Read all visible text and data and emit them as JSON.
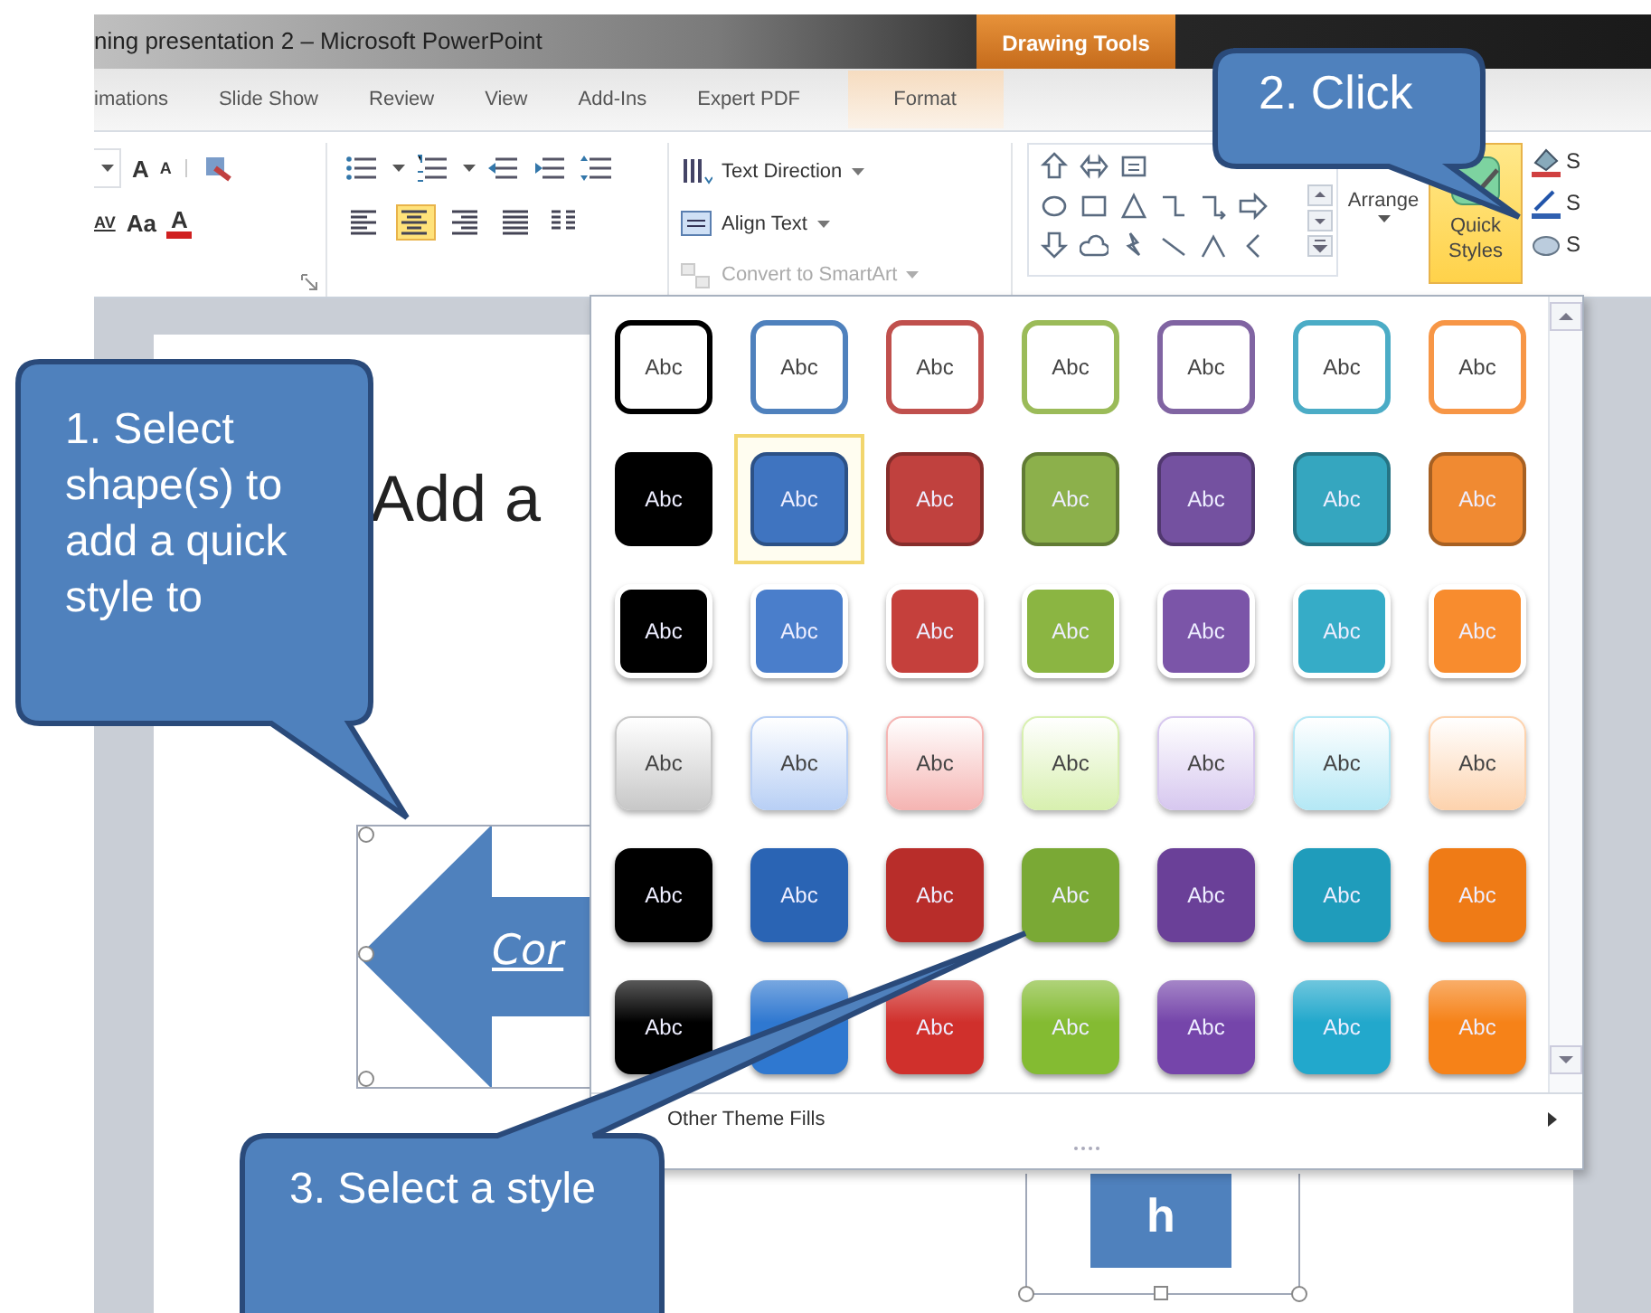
{
  "window": {
    "title": "ning presentation 2 – Microsoft PowerPoint"
  },
  "contextual_tab": {
    "label": "Drawing Tools"
  },
  "tabs": [
    {
      "label": "imations",
      "selected": false
    },
    {
      "label": "Slide Show",
      "selected": false
    },
    {
      "label": "Review",
      "selected": false
    },
    {
      "label": "View",
      "selected": false
    },
    {
      "label": "Add-Ins",
      "selected": false
    },
    {
      "label": "Expert PDF",
      "selected": false
    },
    {
      "label": "Format",
      "selected": true
    }
  ],
  "ribbon": {
    "font_tools": [
      {
        "kind": "grow",
        "label": "A"
      },
      {
        "kind": "shrink",
        "label": "A"
      },
      {
        "kind": "spacing",
        "label": "AV"
      },
      {
        "kind": "case",
        "label": "Aa"
      },
      {
        "kind": "color",
        "label": "A"
      }
    ],
    "alignments": [
      {
        "kind": "left",
        "selected": false
      },
      {
        "kind": "center",
        "selected": true
      },
      {
        "kind": "right",
        "selected": false
      },
      {
        "kind": "justify",
        "selected": false
      }
    ],
    "text_commands": [
      {
        "label": "Text Direction",
        "disabled": false
      },
      {
        "label": "Align Text",
        "disabled": false
      },
      {
        "label": "Convert to SmartArt",
        "disabled": true
      }
    ],
    "arrange": {
      "label": "Arrange"
    },
    "quick_styles": {
      "label": "Quick Styles",
      "highlighted": true
    },
    "shape_commands": [
      {
        "label": "S"
      },
      {
        "label": "S"
      },
      {
        "label": "S"
      }
    ]
  },
  "slide": {
    "title": "Add a",
    "arrow_text": "Cor",
    "box_text": "h"
  },
  "gallery": {
    "rows": [
      {
        "kind": "outline",
        "items": [
          {
            "label": "Abc",
            "color": "#000000",
            "selected": false
          },
          {
            "label": "Abc",
            "color": "#4f81bd",
            "selected": false
          },
          {
            "label": "Abc",
            "color": "#c0504d",
            "selected": false
          },
          {
            "label": "Abc",
            "color": "#9bbb59",
            "selected": false
          },
          {
            "label": "Abc",
            "color": "#8064a2",
            "selected": false
          },
          {
            "label": "Abc",
            "color": "#4bacc6",
            "selected": false
          },
          {
            "label": "Abc",
            "color": "#f79646",
            "selected": false
          }
        ]
      },
      {
        "kind": "solid",
        "items": [
          {
            "label": "Abc",
            "color": "#000000",
            "selected": false
          },
          {
            "label": "Abc",
            "color": "#3f74c0",
            "selected": true
          },
          {
            "label": "Abc",
            "color": "#c0413e",
            "selected": false
          },
          {
            "label": "Abc",
            "color": "#8cb04b",
            "selected": false
          },
          {
            "label": "Abc",
            "color": "#7451a0",
            "selected": false
          },
          {
            "label": "Abc",
            "color": "#35a6bf",
            "selected": false
          },
          {
            "label": "Abc",
            "color": "#f08a32",
            "selected": false
          }
        ]
      },
      {
        "kind": "raised",
        "items": [
          {
            "label": "Abc",
            "color": "#000000",
            "selected": false
          },
          {
            "label": "Abc",
            "color": "#4a7ecb",
            "selected": false
          },
          {
            "label": "Abc",
            "color": "#c5403c",
            "selected": false
          },
          {
            "label": "Abc",
            "color": "#8bb542",
            "selected": false
          },
          {
            "label": "Abc",
            "color": "#7b55a8",
            "selected": false
          },
          {
            "label": "Abc",
            "color": "#36acc7",
            "selected": false
          },
          {
            "label": "Abc",
            "color": "#f88c2e",
            "selected": false
          }
        ]
      },
      {
        "kind": "light",
        "items": [
          {
            "label": "Abc",
            "color": "#c8c8c8",
            "selected": false
          },
          {
            "label": "Abc",
            "color": "#b9d0f5",
            "selected": false
          },
          {
            "label": "Abc",
            "color": "#f5b5b3",
            "selected": false
          },
          {
            "label": "Abc",
            "color": "#d8f0b0",
            "selected": false
          },
          {
            "label": "Abc",
            "color": "#d7c8ef",
            "selected": false
          },
          {
            "label": "Abc",
            "color": "#b5e8f5",
            "selected": false
          },
          {
            "label": "Abc",
            "color": "#fdd3ae",
            "selected": false
          }
        ]
      },
      {
        "kind": "intense",
        "items": [
          {
            "label": "Abc",
            "color": "#000000",
            "selected": false
          },
          {
            "label": "Abc",
            "color": "#2a64b4",
            "selected": false
          },
          {
            "label": "Abc",
            "color": "#b82d2a",
            "selected": false
          },
          {
            "label": "Abc",
            "color": "#7aa935",
            "selected": false
          },
          {
            "label": "Abc",
            "color": "#6a4098",
            "selected": false
          },
          {
            "label": "Abc",
            "color": "#1f9cbb",
            "selected": false
          },
          {
            "label": "Abc",
            "color": "#ef7b16",
            "selected": false
          }
        ]
      },
      {
        "kind": "glossy",
        "items": [
          {
            "label": "Abc",
            "color": "#000000",
            "selected": false
          },
          {
            "color": "#2f78d0",
            "selected": false
          },
          {
            "label": "Abc",
            "color": "#d0302c",
            "selected": false
          },
          {
            "label": "Abc",
            "color": "#84bb32",
            "selected": false
          },
          {
            "label": "Abc",
            "color": "#7545aa",
            "selected": false
          },
          {
            "label": "Abc",
            "color": "#22a8cc",
            "selected": false
          },
          {
            "label": "Abc",
            "color": "#f68218",
            "selected": false
          }
        ]
      }
    ],
    "footer": "Other Theme Fills"
  },
  "callouts": [
    {
      "text": "1. Select shape(s) to add a quick style to"
    },
    {
      "text": "2. Click"
    },
    {
      "text": "3. Select a style"
    }
  ]
}
